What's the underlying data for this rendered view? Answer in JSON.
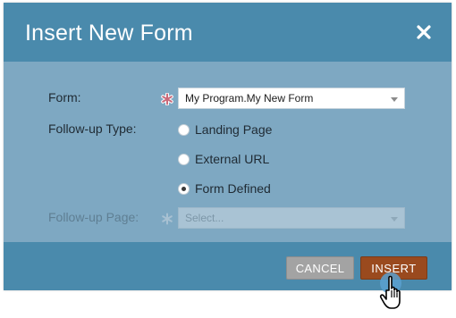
{
  "dialog": {
    "title": "Insert New Form",
    "close_icon": "close-icon"
  },
  "form": {
    "form_label": "Form:",
    "form_value": "My Program.My New Form",
    "followup_type_label": "Follow-up Type:",
    "followup_options": [
      {
        "label": "Landing Page",
        "selected": false
      },
      {
        "label": "External URL",
        "selected": false
      },
      {
        "label": "Form Defined",
        "selected": true
      }
    ],
    "followup_page_label": "Follow-up Page:",
    "followup_page_placeholder": "Select..."
  },
  "footer": {
    "cancel_label": "CANCEL",
    "insert_label": "INSERT"
  },
  "colors": {
    "header": "#4a8aac",
    "body": "#7ea8c2",
    "insert_button": "#9a4a1e",
    "cancel_button": "#a3a3a3",
    "required_asterisk": "#c96a7a"
  }
}
